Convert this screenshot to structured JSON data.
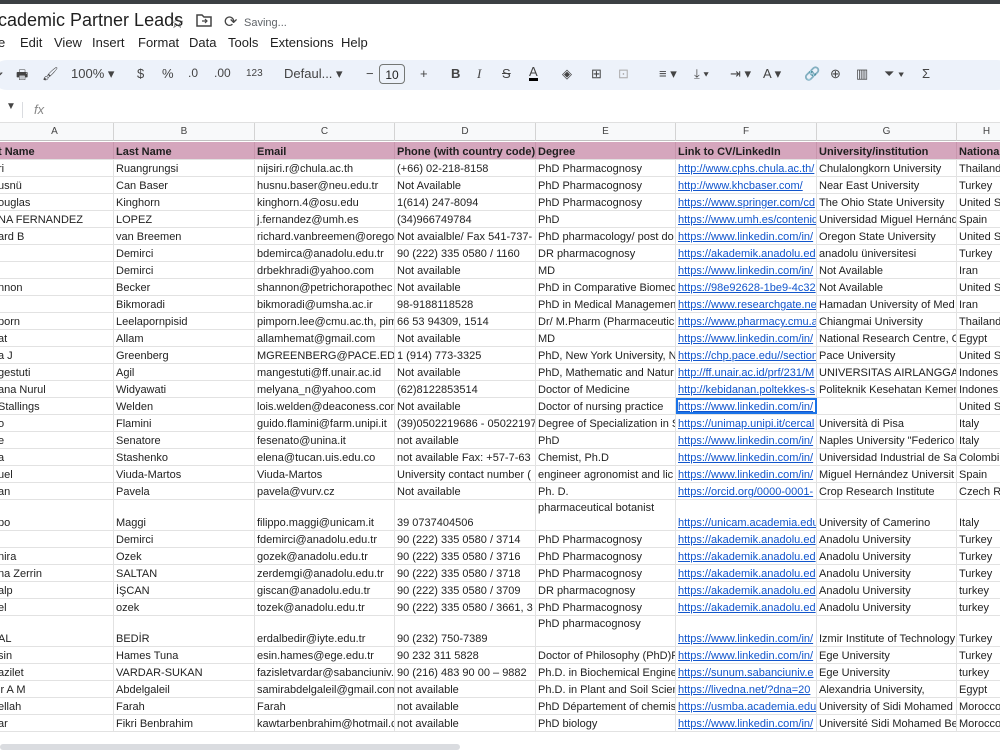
{
  "title": {
    "doc": "cademic Partner Leads",
    "status": "Saving..."
  },
  "menu": [
    "e",
    "Edit",
    "View",
    "Insert",
    "Format",
    "Data",
    "Tools",
    "Extensions",
    "Help"
  ],
  "toolbar": {
    "zoom": "100%",
    "currency": "$",
    "percent": "%",
    "dec_less": ".0",
    "dec_more": ".00",
    "format_123": "123",
    "font": "Defaul...",
    "font_size": "10",
    "minus": "−",
    "plus": "+"
  },
  "formula": {
    "fx": "fx"
  },
  "columns": [
    {
      "letter": "A",
      "header": "t Name"
    },
    {
      "letter": "B",
      "header": "Last Name"
    },
    {
      "letter": "C",
      "header": "Email"
    },
    {
      "letter": "D",
      "header": "Phone (with country code)"
    },
    {
      "letter": "E",
      "header": "Degree"
    },
    {
      "letter": "F",
      "header": "Link to CV/LinkedIn"
    },
    {
      "letter": "G",
      "header": "University/institution"
    },
    {
      "letter": "H",
      "header": "Nationa"
    }
  ],
  "rows": [
    [
      "ri",
      "Ruangrungsi",
      "nijsiri.r@chula.ac.th",
      "(+66) 02-218-8158",
      "PhD Pharmacognosy",
      "http://www.cphs.chula.ac.th/",
      "Chulalongkorn University",
      "Thailand"
    ],
    [
      "usnü",
      "Can Baser",
      "husnu.baser@neu.edu.tr",
      "Not Available",
      "PhD Pharmacognosy",
      "http://www.khcbaser.com/",
      "Near East University",
      "Turkey"
    ],
    [
      "ouglas",
      "Kinghorn",
      "kinghorn.4@osu.edu",
      "1(614) 247-8094",
      "PhD Pharmacognosy",
      "https://www.springer.com/cd",
      "The Ohio State University",
      "United S"
    ],
    [
      "NA FERNANDEZ",
      "LOPEZ",
      "j.fernandez@umh.es",
      "(34)966749784",
      "PhD",
      "https://www.umh.es/contenid",
      "Universidad Miguel Hernánd",
      "Spain"
    ],
    [
      "ard B",
      "van Breemen",
      "richard.vanbreemen@oregon",
      "Not avaialble/ Fax 541-737-",
      "PhD pharmacology/ post do",
      "https://www.linkedin.com/in/",
      "Oregon State University",
      "United S"
    ],
    [
      "l",
      "Demirci",
      "bdemirca@anadolu.edu.tr",
      "90 (222) 335 0580 / 1160",
      "DR pharmacognosy",
      "https://akademik.anadolu.ed",
      "anadolu üniversitesi",
      "Turkey"
    ],
    [
      "l",
      "Demirci",
      "drbekhradi@yahoo.com",
      "Not available",
      "MD",
      "https://www.linkedin.com/in/",
      "Not Available",
      "Iran"
    ],
    [
      "nnon",
      "Becker",
      "shannon@petrichorapothec",
      "Not available",
      "PhD in Comparative Biomed",
      "https://98e92628-1be9-4c32",
      "Not Available",
      "United S"
    ],
    [
      "",
      "Bikmoradi",
      "bikmoradi@umsha.ac.ir",
      "98-9188118528",
      "PhD in Medical Managemen",
      "https://www.researchgate.ne",
      "Hamadan University of Med",
      "Iran"
    ],
    [
      "porn",
      "Leelapornpisid",
      "pimporn.lee@cmu.ac.th, pim",
      "66 53 94309, 1514",
      "Dr/ M.Pharm (Pharmaceutic",
      "https://www.pharmacy.cmu.a",
      "Chiangmai University",
      "Thailand"
    ],
    [
      "at",
      "Allam",
      "allamhemat@gmail.com",
      "Not available",
      "MD",
      "https://www.linkedin.com/in/",
      "National Research Centre, C",
      "Egypt"
    ],
    [
      "a J",
      "Greenberg",
      "MGREENBERG@PACE.ED",
      "1 (914) 773-3325",
      "PhD, New York University, N",
      "https://chp.pace.edu//section",
      "Pace University",
      "United S"
    ],
    [
      "gestuti",
      "Agil",
      "mangestuti@ff.unair.ac.id",
      "Not available",
      "PhD, Mathematic and Natur",
      "http://ff.unair.ac.id/prf/231/M",
      "UNIVERSITAS AIRLANGGA",
      "Indones"
    ],
    [
      "ana Nurul",
      "Widyawati",
      "melyana_n@yahoo.com",
      "(62)8122853514",
      "Doctor of Medicine",
      "http://kebidanan.poltekkes-s",
      "Politeknik Kesehatan Kemen",
      "Indones"
    ],
    [
      "Stallings",
      "Welden",
      "lois.welden@deaconess.com",
      "Not available",
      "Doctor of nursing practice",
      "https://www.linkedin.com/in/",
      "",
      "United S"
    ],
    [
      "o",
      "Flamini",
      "guido.flamini@farm.unipi.it",
      "(39)0502219686 - 05022197",
      "Degree of Specialization in S",
      "https://unimap.unipi.it/cercal",
      "Università di Pisa",
      "Italy"
    ],
    [
      "e",
      "Senatore",
      "fesenato@unina.it",
      "not available",
      "PhD",
      "https://www.linkedin.com/in/",
      "Naples University \"Federico",
      "Italy"
    ],
    [
      "a",
      "Stashenko",
      "elena@tucan.uis.edu.co",
      "not available Fax: +57-7-63",
      "Chemist, Ph.D",
      "https://www.linkedin.com/in/",
      "Universidad Industrial de Sa",
      "Colombi"
    ],
    [
      "uel",
      "Viuda-Martos",
      "Viuda-Martos",
      "University contact number (",
      "engineer agronomist and lic",
      "https://www.linkedin.com/in/",
      "Miguel Hernández Universit",
      "Spain"
    ],
    [
      "an",
      "Pavela",
      "pavela@vurv.cz",
      "Not available",
      "Ph. D.",
      "https://orcid.org/0000-0001-",
      "Crop Research Institute",
      "Czech R"
    ],
    [
      "po",
      "Maggi",
      "filippo.maggi@unicam.it",
      "39 0737404506",
      "pharmaceutical botanist",
      "https://unicam.academia.edu",
      "University of Camerino",
      "Italy"
    ],
    [
      "",
      "Demirci",
      "fdemirci@anadolu.edu.tr",
      "90 (222) 335 0580 / 3714",
      "PhD Pharmacognosy",
      "https://akademik.anadolu.ed",
      "Anadolu University",
      "Turkey"
    ],
    [
      "nira",
      "Ozek",
      "gozek@anadolu.edu.tr",
      "90 (222) 335 0580 / 3716",
      "PhD Pharmacognosy",
      "https://akademik.anadolu.ed",
      "Anadolu University",
      "Turkey"
    ],
    [
      "na Zerrin",
      "SALTAN",
      "zerdemgi@anadolu.edu.tr",
      "90 (222) 335 0580 / 3718",
      "PhD Pharmacognosy",
      "https://akademik.anadolu.ed",
      "Anadolu University",
      "Turkey"
    ],
    [
      "alp",
      "İŞCAN",
      "giscan@anadolu.edu.tr",
      "90 (222) 335 0580 / 3709",
      "DR pharmacognosy",
      "https://akademik.anadolu.ed",
      "Anadolu University",
      "turkey"
    ],
    [
      "el",
      "ozek",
      "tozek@anadolu.edu.tr",
      "90 (222) 335 0580 / 3661, 3",
      "PhD Pharmacognosy",
      "https://akademik.anadolu.ed",
      "Anadolu University",
      "turkey"
    ],
    [
      "AL",
      "BEDİR",
      "erdalbedir@iyte.edu.tr",
      "90 (232) 750-7389",
      "PhD pharmacognosy",
      "https://www.linkedin.com/in/",
      "Izmir Institute of Technology",
      "Turkey"
    ],
    [
      "sin",
      "Hames Tuna",
      "esin.hames@ege.edu.tr",
      "90 232 311 5828",
      "Doctor of Philosophy (PhD)F",
      "https://www.linkedin.com/in/",
      "Ege University",
      "Turkey"
    ],
    [
      "azilet",
      "VARDAR-SUKAN",
      "fazisletvardar@sabanciuniv.e",
      "90 (216) 483 90 00 – 9882",
      "Ph.D. in Biochemical Engine",
      "https://sunum.sabanciuniv.e",
      "Ege University",
      "turkey"
    ],
    [
      "ir A M",
      "Abdelgaleil",
      "samirabdelgaleil@gmail.com",
      "not available",
      "Ph.D. in Plant and Soil Scien",
      "https://livedna.net/?dna=20",
      "Alexandria University,",
      "Egypt"
    ],
    [
      "ellah",
      "Farah",
      "Farah",
      "not available",
      "PhD Département of chemis",
      "https://usmba.academia.edu",
      "University of Sidi Mohamed",
      "Morocco"
    ],
    [
      "ar",
      "Fikri Benbrahim",
      "kawtarbenbrahim@hotmail.c",
      "not available",
      "PhD biology",
      "https://www.linkedin.com/in/",
      "Université Sidi Mohamed Be",
      "Morocco"
    ]
  ]
}
